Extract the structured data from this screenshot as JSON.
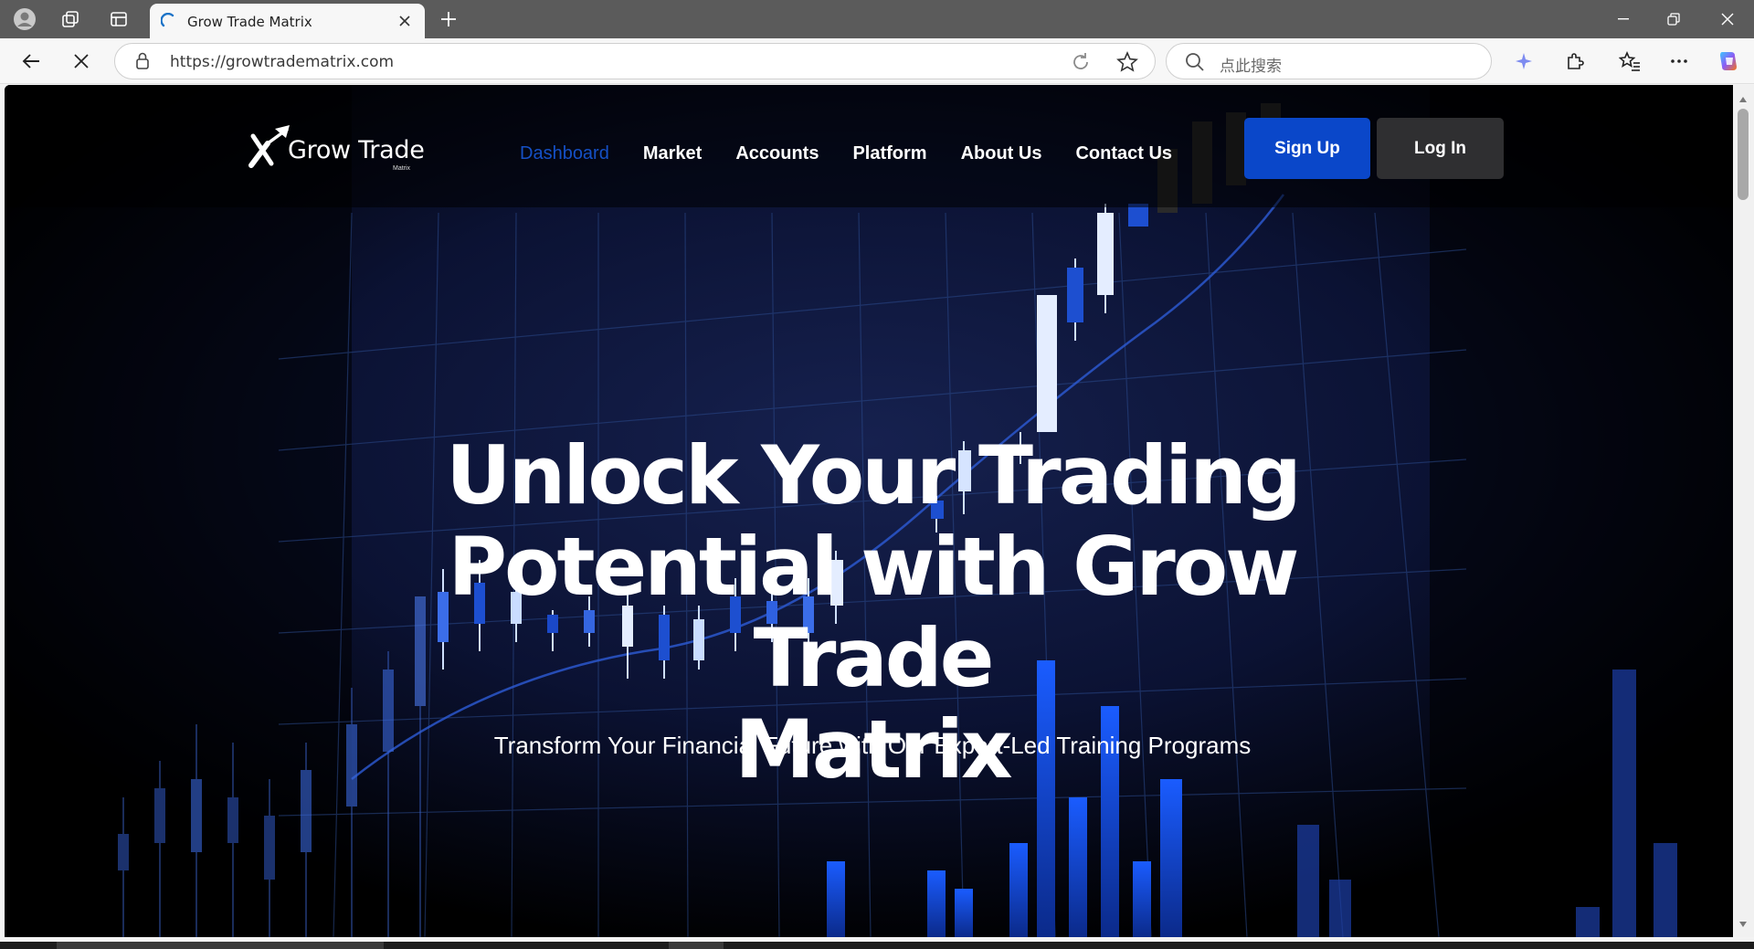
{
  "browser": {
    "tab": {
      "title": "Grow Trade Matrix"
    },
    "address": {
      "url": "https://growtradematrix.com"
    },
    "search": {
      "placeholder": "点此搜索"
    }
  },
  "site": {
    "logo": {
      "name": "Grow Trade",
      "sub": "Matrix"
    },
    "nav": [
      {
        "label": "Dashboard",
        "active": true
      },
      {
        "label": "Market"
      },
      {
        "label": "Accounts"
      },
      {
        "label": "Platform"
      },
      {
        "label": "About Us"
      },
      {
        "label": "Contact Us"
      }
    ],
    "signup_label": "Sign Up",
    "login_label": "Log In",
    "hero": {
      "title_line1": "Unlock Your Trading",
      "title_line2": "Potential with Grow Trade",
      "title_line3": "Matrix",
      "subtitle": "Transform Your Financial Future with Our Expert-Led Training Programs"
    }
  },
  "colors": {
    "accent": "#0a47c9",
    "active_nav": "#1550c5",
    "login_bg": "#2f2f31",
    "page_bg": "#000000"
  }
}
